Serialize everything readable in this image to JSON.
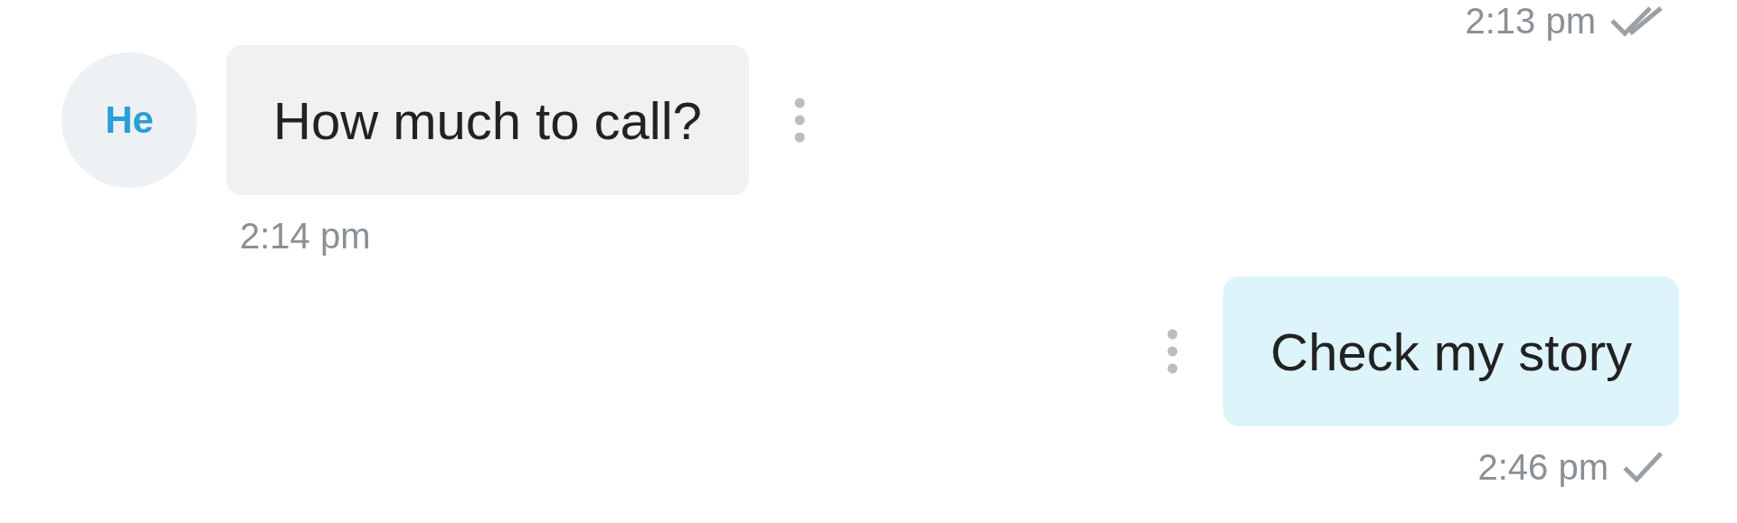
{
  "messages": [
    {
      "kind": "timestamp",
      "time": "2:13 pm",
      "read": true
    },
    {
      "kind": "incoming",
      "avatar": "He",
      "text": "How much to call?",
      "time": "2:14 pm"
    },
    {
      "kind": "outgoing",
      "text": "Check my story",
      "time": "2:46 pm",
      "read": false
    }
  ]
}
